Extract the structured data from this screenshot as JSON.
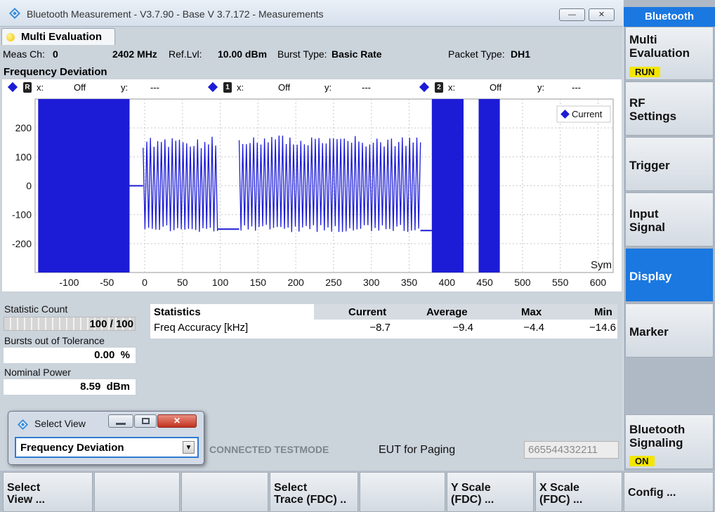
{
  "window": {
    "title": "Bluetooth Measurement  - V3.7.90 - Base V 3.7.172 - Measurements",
    "min_glyph": "—",
    "close_glyph": "✕"
  },
  "tab": {
    "label": "Multi Evaluation",
    "status_color": "#f2c200"
  },
  "info_bar": {
    "meas_ch_label": "Meas Ch:",
    "meas_ch_value": "0",
    "freq": "2402 MHz",
    "ref_lvl_label": "Ref.Lvl:",
    "ref_lvl_value": "10.00 dBm",
    "burst_type_label": "Burst Type:",
    "burst_type_value": "Basic Rate",
    "packet_type_label": "Packet Type:",
    "packet_type_value": "DH1"
  },
  "section_title": "Frequency Deviation",
  "markers": [
    {
      "id": "R",
      "x_label": "x:",
      "x_value": "Off",
      "y_label": "y:",
      "y_value": "---"
    },
    {
      "id": "1",
      "x_label": "x:",
      "x_value": "Off",
      "y_label": "y:",
      "y_value": "---"
    },
    {
      "id": "2",
      "x_label": "x:",
      "x_value": "Off",
      "y_label": "y:",
      "y_value": "---"
    }
  ],
  "chart_data": {
    "type": "line",
    "title": "Frequency Deviation",
    "xlabel": "Sym",
    "ylabel": "",
    "x_ticks": [
      -100,
      -50,
      0,
      50,
      100,
      150,
      200,
      250,
      300,
      350,
      400,
      450,
      500,
      550,
      600
    ],
    "y_ticks": [
      200,
      100,
      0,
      -100,
      -200
    ],
    "xlim": [
      -145,
      620
    ],
    "ylim": [
      -300,
      300
    ],
    "grid": true,
    "legend_position": "top-right",
    "series": [
      {
        "name": "Current",
        "color": "#1c1cd6",
        "segments": [
          {
            "kind": "fill",
            "x_start": -141,
            "x_end": -20,
            "y_min": -300,
            "y_max": 300
          },
          {
            "kind": "flat",
            "x_start": -20,
            "x_end": -2,
            "y": 0
          },
          {
            "kind": "burst",
            "x_start": -2,
            "x_end": 97,
            "y_min": -160,
            "y_max": 170
          },
          {
            "kind": "flat",
            "x_start": 97,
            "x_end": 125,
            "y": -150
          },
          {
            "kind": "burst",
            "x_start": 125,
            "x_end": 365,
            "y_min": -160,
            "y_max": 175
          },
          {
            "kind": "flat",
            "x_start": 365,
            "x_end": 380,
            "y": -155
          },
          {
            "kind": "fill",
            "x_start": 380,
            "x_end": 422,
            "y_min": -300,
            "y_max": 300
          },
          {
            "kind": "fill",
            "x_start": 442,
            "x_end": 470,
            "y_min": -300,
            "y_max": 300
          }
        ]
      }
    ]
  },
  "stats": {
    "statistic_count_label": "Statistic Count",
    "statistic_count_value": "100 / 100",
    "statistic_count_fraction": 1.0,
    "bursts_label": "Bursts out of Tolerance",
    "bursts_value": "0.00",
    "bursts_unit": "%",
    "nominal_power_label": "Nominal Power",
    "nominal_power_value": "8.59",
    "nominal_power_unit": "dBm"
  },
  "stat_table": {
    "headers": [
      "Statistics",
      "Current",
      "Average",
      "Max",
      "Min"
    ],
    "row": {
      "label": "Freq Accuracy [kHz]",
      "current": "−8.7",
      "average": "−9.4",
      "max": "−4.4",
      "min": "−14.6"
    }
  },
  "connection": {
    "status": "CONNECTED TESTMODE",
    "eut_label": "EUT for Paging",
    "address": "665544332211"
  },
  "popup": {
    "title": "Select View",
    "selected": "Frequency Deviation",
    "close_glyph": "✕",
    "dropdown_glyph": "▼"
  },
  "sidebar": {
    "header": "Bluetooth",
    "buttons": [
      {
        "label": "Multi\nEvaluation",
        "badge": "RUN"
      },
      {
        "label": "RF\nSettings"
      },
      {
        "label": "Trigger"
      },
      {
        "label": "Input\nSignal"
      },
      {
        "label": "Display",
        "active": true
      },
      {
        "label": "Marker"
      },
      {
        "label": "Bluetooth\nSignaling",
        "badge": "ON"
      }
    ],
    "accent_color": "#1a78e0",
    "badge_color": "#f3e600"
  },
  "softkeys": [
    {
      "label": "Select\nView ..."
    },
    {
      "label": ""
    },
    {
      "label": ""
    },
    {
      "label": "Select\nTrace (FDC) .."
    },
    {
      "label": ""
    },
    {
      "label": "Y Scale\n(FDC) ..."
    },
    {
      "label": "X Scale\n(FDC) ..."
    },
    {
      "label": "Config ..."
    }
  ]
}
